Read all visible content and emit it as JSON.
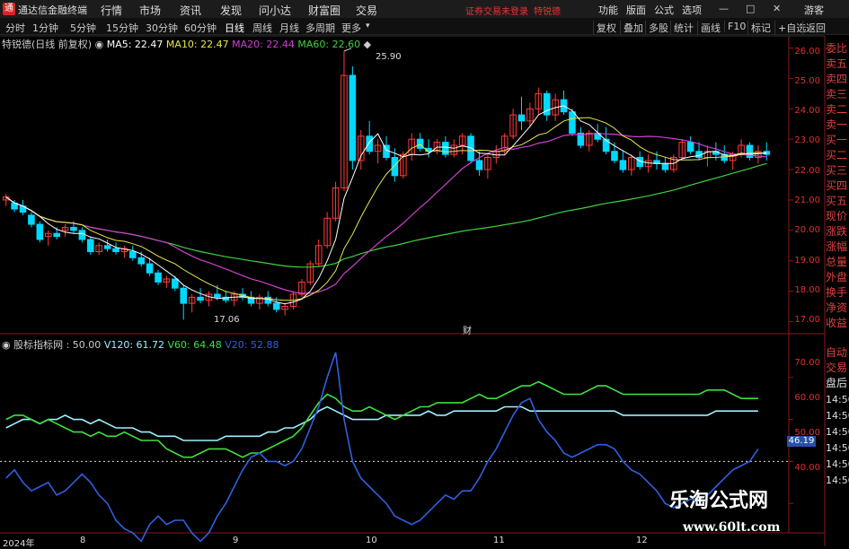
{
  "titlebar": {
    "logo": "通",
    "app_title": "通达信金融终端",
    "menus": [
      "行情",
      "市场",
      "资讯",
      "发现",
      "问小达",
      "财富圈",
      "交易"
    ],
    "login_warning": "证券交易未登录",
    "stock_name": "特锐德",
    "right_menus": [
      "功能",
      "版面",
      "公式",
      "选项"
    ],
    "guest": "游客"
  },
  "toolbar": {
    "periods": [
      "分时",
      "1分钟",
      "5分钟",
      "15分钟",
      "30分钟",
      "60分钟",
      "日线",
      "周线",
      "月线",
      "多周期",
      "更多"
    ],
    "active_period": "日线",
    "right_tools": [
      "复权",
      "叠加",
      "多股",
      "统计",
      "画线",
      "F10",
      "标记",
      "+自选",
      "返回"
    ]
  },
  "main_legend": {
    "title": "特锐德(日线 前复权)",
    "ma5_label": "MA5: 22.47",
    "ma10_label": "MA10: 22.47",
    "ma20_label": "MA20: 22.44",
    "ma60_label": "MA60: 22.60"
  },
  "price_axis": [
    "26.00",
    "25.00",
    "24.00",
    "23.00",
    "22.00",
    "21.00",
    "20.00",
    "19.00",
    "18.00",
    "17.00"
  ],
  "price_annotations": {
    "high": "25.90",
    "low": "17.06",
    "cai_marker": "财"
  },
  "sub_legend": {
    "title": "股标指标网 : 50.00",
    "v120": "V120: 61.72",
    "v60": "V60: 64.48",
    "v20": "V20: 52.88"
  },
  "sub_axis": [
    "70.00",
    "60.00",
    "50.00",
    "40.00"
  ],
  "sub_last_value": "46.19",
  "x_axis": [
    "2024年",
    "8",
    "9",
    "10",
    "11",
    "12"
  ],
  "right_panel": [
    "委比",
    "卖五",
    "卖四",
    "卖三",
    "卖二",
    "卖一",
    "买一",
    "买二",
    "买三",
    "买四",
    "买五",
    "现价",
    "涨跌",
    "涨幅",
    "总量",
    "外盘",
    "换手",
    "净资",
    "收益",
    "自动",
    "交易",
    "盘后",
    "14:50",
    "14:50",
    "14:50",
    "14:50",
    "14:50",
    "14:50"
  ],
  "watermark": {
    "line1": "乐淘公式网",
    "line2": "www.60lt.com"
  },
  "colors": {
    "up": "#ff3b3b",
    "down": "#00d8ff",
    "ma5": "#ffffff",
    "ma10": "#e8e84a",
    "ma20": "#d040d0",
    "ma60": "#40d040",
    "v120": "#9ef0ff",
    "v60": "#40e040",
    "v20": "#3060e0"
  },
  "chart_data": {
    "type": "candlestick",
    "candles": [
      [
        21.0,
        21.2,
        20.8,
        21.1
      ],
      [
        20.9,
        21.0,
        20.6,
        20.7
      ],
      [
        20.8,
        21.0,
        20.5,
        20.6
      ],
      [
        20.5,
        20.6,
        20.1,
        20.2
      ],
      [
        20.2,
        20.3,
        19.6,
        19.7
      ],
      [
        19.8,
        20.0,
        19.5,
        19.9
      ],
      [
        19.9,
        20.1,
        19.7,
        19.8
      ],
      [
        20.0,
        20.2,
        19.8,
        20.1
      ],
      [
        20.1,
        20.3,
        19.9,
        20.0
      ],
      [
        20.0,
        20.1,
        19.6,
        19.7
      ],
      [
        19.7,
        19.8,
        19.2,
        19.3
      ],
      [
        19.3,
        19.6,
        19.2,
        19.5
      ],
      [
        19.5,
        19.7,
        19.3,
        19.4
      ],
      [
        19.4,
        19.6,
        19.2,
        19.3
      ],
      [
        19.3,
        19.5,
        19.1,
        19.4
      ],
      [
        19.3,
        19.5,
        19.0,
        19.1
      ],
      [
        19.1,
        19.3,
        18.8,
        18.9
      ],
      [
        18.9,
        19.1,
        18.5,
        18.6
      ],
      [
        18.6,
        18.7,
        18.2,
        18.3
      ],
      [
        18.3,
        18.5,
        18.1,
        18.4
      ],
      [
        18.4,
        18.5,
        18.0,
        18.1
      ],
      [
        18.1,
        18.2,
        17.06,
        17.6
      ],
      [
        17.6,
        17.9,
        17.3,
        17.8
      ],
      [
        17.8,
        18.1,
        17.6,
        17.7
      ],
      [
        17.7,
        18.0,
        17.5,
        17.9
      ],
      [
        17.9,
        18.2,
        17.7,
        17.8
      ],
      [
        17.8,
        18.0,
        17.6,
        17.7
      ],
      [
        17.7,
        18.0,
        17.5,
        17.9
      ],
      [
        17.9,
        18.1,
        17.7,
        17.8
      ],
      [
        17.8,
        18.0,
        17.5,
        17.6
      ],
      [
        17.6,
        17.9,
        17.4,
        17.8
      ],
      [
        17.8,
        18.0,
        17.5,
        17.6
      ],
      [
        17.6,
        17.8,
        17.3,
        17.4
      ],
      [
        17.4,
        17.6,
        17.2,
        17.5
      ],
      [
        17.5,
        18.0,
        17.4,
        17.9
      ],
      [
        17.9,
        18.4,
        17.8,
        18.3
      ],
      [
        18.3,
        19.0,
        18.2,
        18.9
      ],
      [
        18.9,
        19.7,
        18.8,
        19.5
      ],
      [
        19.5,
        20.6,
        19.4,
        20.4
      ],
      [
        20.4,
        21.6,
        20.3,
        21.4
      ],
      [
        21.4,
        25.9,
        21.3,
        25.1
      ],
      [
        25.1,
        25.4,
        22.0,
        22.3
      ],
      [
        22.3,
        23.3,
        22.0,
        23.1
      ],
      [
        23.1,
        23.6,
        22.5,
        22.6
      ],
      [
        22.6,
        23.0,
        22.2,
        22.8
      ],
      [
        22.8,
        23.1,
        22.3,
        22.4
      ],
      [
        22.4,
        22.7,
        21.6,
        21.8
      ],
      [
        21.8,
        22.6,
        21.7,
        22.5
      ],
      [
        22.5,
        23.2,
        22.3,
        23.0
      ],
      [
        23.0,
        23.2,
        22.6,
        22.7
      ],
      [
        22.7,
        23.0,
        22.4,
        22.6
      ],
      [
        22.6,
        23.0,
        22.5,
        22.9
      ],
      [
        22.9,
        23.1,
        22.4,
        22.5
      ],
      [
        22.5,
        23.0,
        22.4,
        22.8
      ],
      [
        22.8,
        23.2,
        22.5,
        23.1
      ],
      [
        23.1,
        23.2,
        22.2,
        22.3
      ],
      [
        22.3,
        22.6,
        21.8,
        22.0
      ],
      [
        22.0,
        22.5,
        21.7,
        22.4
      ],
      [
        22.4,
        22.8,
        22.2,
        22.6
      ],
      [
        22.6,
        23.2,
        22.5,
        23.1
      ],
      [
        23.1,
        24.0,
        23.0,
        23.8
      ],
      [
        23.8,
        24.4,
        23.3,
        23.6
      ],
      [
        23.6,
        24.2,
        23.4,
        24.0
      ],
      [
        24.0,
        24.7,
        23.8,
        24.5
      ],
      [
        24.5,
        24.6,
        23.6,
        23.8
      ],
      [
        23.8,
        24.5,
        23.6,
        24.3
      ],
      [
        24.3,
        24.6,
        23.8,
        23.9
      ],
      [
        23.9,
        24.0,
        23.1,
        23.2
      ],
      [
        23.2,
        23.4,
        22.7,
        22.8
      ],
      [
        22.8,
        23.3,
        22.6,
        23.2
      ],
      [
        23.2,
        23.5,
        22.9,
        23.0
      ],
      [
        23.0,
        23.4,
        22.5,
        22.6
      ],
      [
        22.6,
        22.9,
        22.2,
        22.3
      ],
      [
        22.3,
        22.6,
        21.9,
        22.0
      ],
      [
        22.0,
        22.5,
        21.8,
        22.4
      ],
      [
        22.4,
        22.6,
        22.0,
        22.1
      ],
      [
        22.1,
        22.5,
        21.9,
        22.3
      ],
      [
        22.3,
        22.6,
        22.0,
        22.2
      ],
      [
        22.2,
        22.4,
        21.9,
        22.0
      ],
      [
        22.0,
        22.5,
        21.9,
        22.4
      ],
      [
        22.4,
        23.0,
        22.3,
        22.9
      ],
      [
        22.9,
        23.1,
        22.5,
        22.6
      ],
      [
        22.6,
        22.9,
        22.3,
        22.4
      ],
      [
        22.4,
        22.8,
        22.1,
        22.6
      ],
      [
        22.6,
        22.9,
        22.3,
        22.5
      ],
      [
        22.5,
        22.8,
        22.2,
        22.3
      ],
      [
        22.3,
        22.6,
        22.0,
        22.5
      ],
      [
        22.5,
        23.0,
        22.4,
        22.8
      ],
      [
        22.8,
        22.9,
        22.3,
        22.4
      ],
      [
        22.4,
        22.8,
        22.2,
        22.6
      ],
      [
        22.6,
        22.9,
        22.3,
        22.5
      ]
    ],
    "ylim": [
      16.6,
      26.4
    ],
    "series": [
      {
        "name": "V120",
        "values": [
          58,
          59,
          60,
          60,
          59,
          60,
          60,
          61,
          60,
          60,
          59,
          60,
          59,
          58,
          58,
          58,
          57,
          57,
          56,
          56,
          56,
          55,
          55,
          55,
          55,
          55,
          56,
          56,
          56,
          56,
          56,
          57,
          57,
          58,
          58,
          59,
          60,
          62,
          63,
          62,
          61,
          60,
          60,
          60,
          60,
          61,
          61,
          61,
          61,
          61,
          62,
          61,
          61,
          62,
          62,
          62,
          62,
          62,
          62,
          63,
          63,
          63,
          62,
          62,
          62,
          62,
          62,
          62,
          62,
          62,
          62,
          62,
          62,
          61,
          61,
          61,
          61,
          61,
          61,
          61,
          61,
          61,
          61,
          61,
          62,
          62,
          62,
          62,
          62,
          62
        ]
      },
      {
        "name": "V60",
        "values": [
          60,
          61,
          61,
          60,
          59,
          60,
          59,
          58,
          57,
          57,
          56,
          57,
          56,
          56,
          57,
          56,
          55,
          55,
          55,
          53,
          52,
          51,
          51,
          52,
          53,
          53,
          53,
          52,
          51,
          52,
          52,
          53,
          54,
          55,
          56,
          58,
          61,
          64,
          66,
          65,
          63,
          62,
          62,
          63,
          62,
          61,
          60,
          61,
          62,
          63,
          63,
          64,
          64,
          64,
          64,
          65,
          66,
          65,
          65,
          66,
          67,
          68,
          68,
          69,
          68,
          67,
          66,
          66,
          66,
          67,
          68,
          68,
          67,
          66,
          66,
          66,
          66,
          66,
          66,
          66,
          66,
          66,
          66,
          67,
          67,
          67,
          66,
          65,
          65,
          65
        ]
      },
      {
        "name": "V20",
        "values": [
          46,
          48,
          45,
          43,
          44,
          45,
          42,
          43,
          45,
          47,
          45,
          42,
          40,
          36,
          34,
          33,
          31,
          35,
          37,
          35,
          36,
          36,
          33,
          31,
          33,
          37,
          40,
          44,
          48,
          51,
          52,
          50,
          50,
          49,
          50,
          53,
          58,
          63,
          70,
          76,
          60,
          50,
          46,
          44,
          42,
          40,
          37,
          36,
          35,
          36,
          38,
          40,
          42,
          41,
          43,
          43,
          46,
          50,
          53,
          57,
          61,
          64,
          65,
          60,
          57,
          55,
          52,
          51,
          52,
          53,
          54,
          54,
          53,
          50,
          48,
          47,
          45,
          43,
          40,
          39,
          40,
          41,
          41,
          42,
          44,
          46,
          48,
          49,
          50,
          53
        ]
      }
    ],
    "sub_ylim": [
      33,
      77
    ]
  }
}
